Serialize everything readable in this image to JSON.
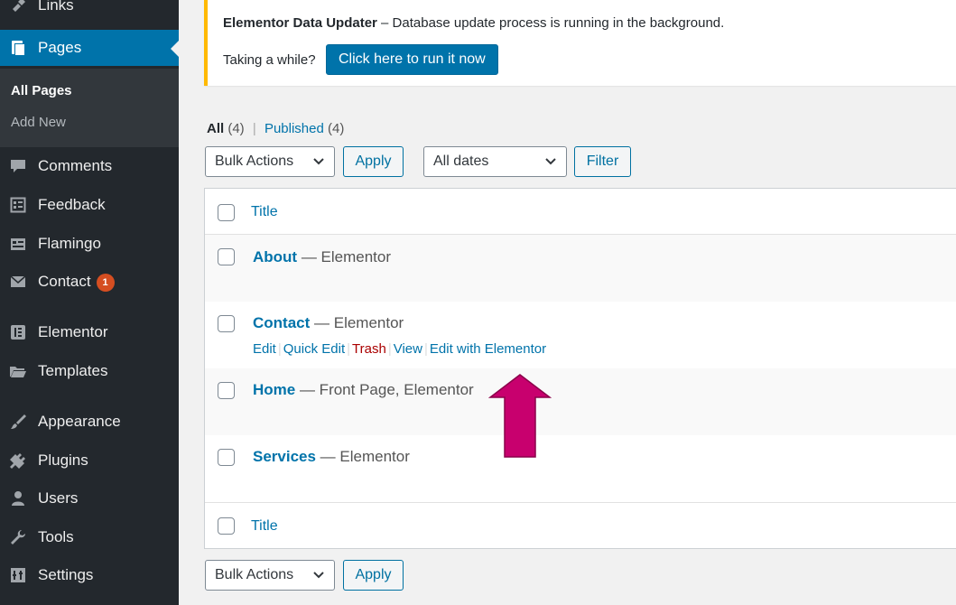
{
  "sidebar": {
    "links_label": "Links",
    "pages_label": "Pages",
    "submenu": {
      "all_pages": "All Pages",
      "add_new": "Add New"
    },
    "comments_label": "Comments",
    "feedback_label": "Feedback",
    "flamingo_label": "Flamingo",
    "contact_label": "Contact",
    "contact_badge": "1",
    "elementor_label": "Elementor",
    "templates_label": "Templates",
    "appearance_label": "Appearance",
    "plugins_label": "Plugins",
    "users_label": "Users",
    "tools_label": "Tools",
    "settings_label": "Settings"
  },
  "notice": {
    "title_bold": "Elementor Data Updater",
    "title_rest": " – Database update process is running in the background.",
    "question": "Taking a while?",
    "button": "Click here to run it now"
  },
  "filters": {
    "all_label": "All",
    "all_count": "(4)",
    "separator": "|",
    "published_label": "Published",
    "published_count": "(4)",
    "bulk_actions": "Bulk Actions",
    "apply": "Apply",
    "dates": "All dates",
    "filter": "Filter"
  },
  "table": {
    "header_title": "Title",
    "footer_title": "Title",
    "rows": [
      {
        "title": "About",
        "state": " — Elementor"
      },
      {
        "title": "Contact",
        "state": " — Elementor"
      },
      {
        "title": "Home",
        "state": " — Front Page, Elementor"
      },
      {
        "title": "Services",
        "state": " — Elementor"
      }
    ],
    "row_actions": {
      "edit": "Edit",
      "quick_edit": "Quick Edit",
      "trash": "Trash",
      "view": "View",
      "edit_elementor": "Edit with Elementor",
      "sep": "|"
    }
  },
  "bottom": {
    "bulk_actions": "Bulk Actions",
    "apply": "Apply"
  },
  "colors": {
    "accent": "#0073aa",
    "sidebar": "#23282d",
    "arrow": "#c8006e",
    "notice_border": "#ffb900"
  }
}
